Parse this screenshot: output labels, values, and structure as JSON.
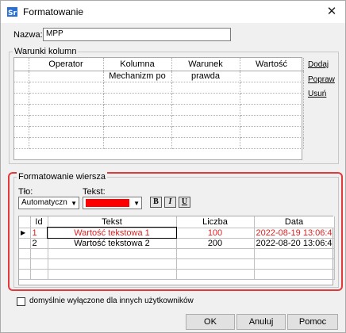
{
  "window": {
    "title": "Formatowanie",
    "close_glyph": "✕",
    "app_icon": "sr-app-icon"
  },
  "name": {
    "label": "Nazwa:",
    "value": "MPP"
  },
  "column_conditions": {
    "caption": "Warunki kolumn",
    "headers": [
      "Operator",
      "Kolumna",
      "Warunek",
      "Wartość"
    ],
    "rows": [
      [
        "",
        "Mechanizm po",
        "prawda",
        ""
      ]
    ],
    "actions": {
      "add": "Dodaj",
      "edit": "Popraw",
      "delete": "Usuń"
    }
  },
  "row_format": {
    "caption": "Formatowanie wiersza",
    "background_label": "Tło:",
    "background_value": "Automatyczn",
    "text_label": "Tekst:",
    "text_color": "#ff0000",
    "bold_label": "B",
    "italic_label": "I",
    "underline_label": "U",
    "headers": [
      "Id",
      "Tekst",
      "Liczba",
      "Data"
    ],
    "rows": [
      {
        "id": "1",
        "text": "Wartość tekstowa 1",
        "number": "100",
        "date": "2022-08-19 13:06:4",
        "color": "#e02020",
        "current": true
      },
      {
        "id": "2",
        "text": "Wartość tekstowa 2",
        "number": "200",
        "date": "2022-08-20 13:06:4",
        "color": "#000000",
        "current": false
      }
    ]
  },
  "options": {
    "disabled_for_others_label": "domyślnie wyłączone dla innych użytkowników",
    "checked": false
  },
  "buttons": {
    "ok": "OK",
    "cancel": "Anuluj",
    "help": "Pomoc"
  }
}
